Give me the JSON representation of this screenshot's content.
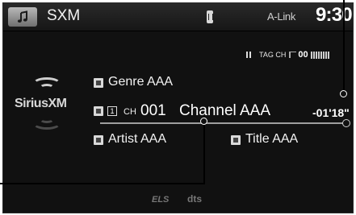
{
  "header": {
    "app_name": "SXM",
    "alink_label": "A-Link",
    "clock": "9:30"
  },
  "signal": {
    "tag_ch_label": "TAG CH",
    "volume_value": "00"
  },
  "logo": {
    "text": "SiriusXM"
  },
  "now_playing": {
    "genre": "Genre AAA",
    "preset": "1",
    "ch_label": "CH",
    "channel_number": "001",
    "channel_name": "Channel AAA",
    "time": "-01'18\"",
    "artist": "Artist AAA",
    "title": "Title AAA"
  },
  "footer": {
    "els_logo": "ELS",
    "dts_logo": "dts"
  },
  "icons": [
    "music-icon",
    "bluetooth-icon",
    "pause-icon",
    "volume-icon",
    "genre-icon",
    "category-icon",
    "artist-icon",
    "title-icon"
  ]
}
